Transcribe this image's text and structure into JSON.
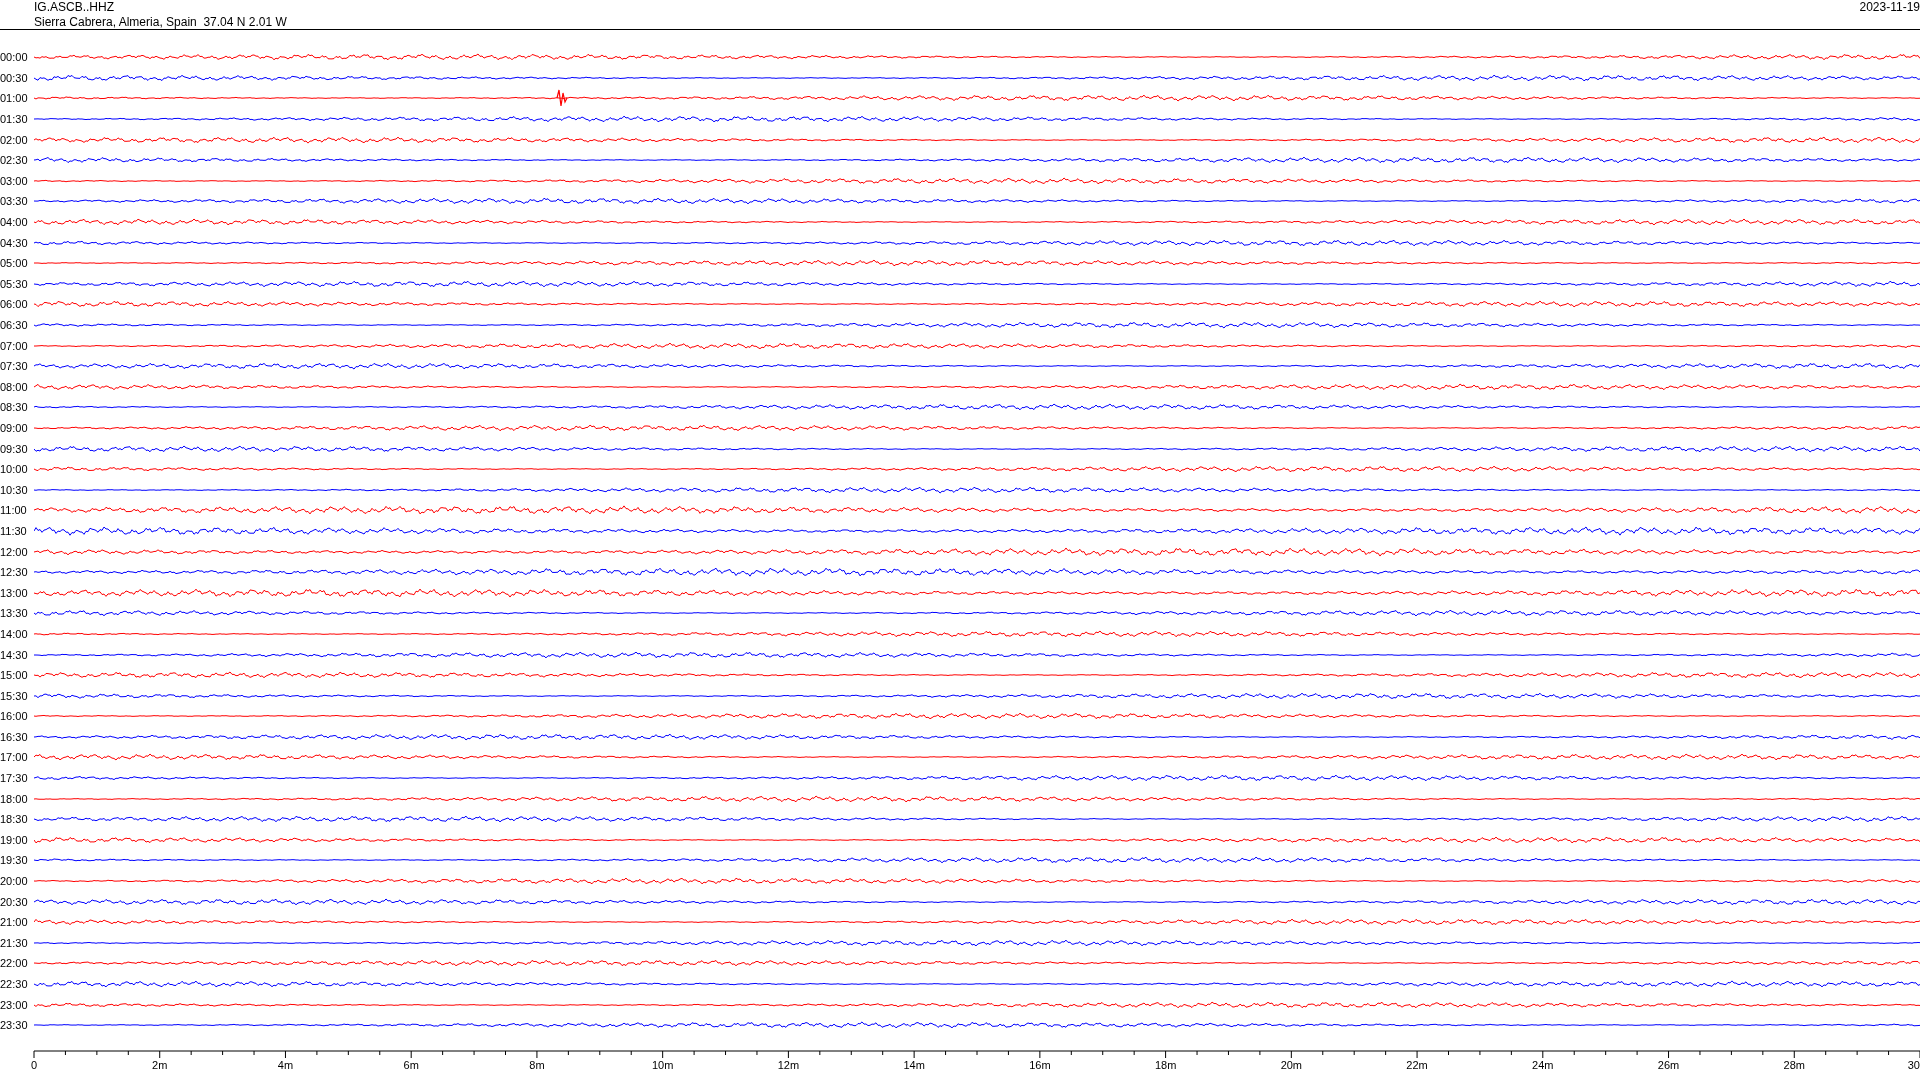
{
  "header": {
    "station": "IG.ASCB..HHZ",
    "location": "Sierra Cabrera, Almeria, Spain  37.04 N 2.01 W",
    "date": "2023-11-19"
  },
  "rows": [
    {
      "label": "00:00",
      "color": "#ff0000"
    },
    {
      "label": "00:30",
      "color": "#0000ff"
    },
    {
      "label": "01:00",
      "color": "#ff0000"
    },
    {
      "label": "01:30",
      "color": "#0000ff"
    },
    {
      "label": "02:00",
      "color": "#ff0000"
    },
    {
      "label": "02:30",
      "color": "#0000ff"
    },
    {
      "label": "03:00",
      "color": "#ff0000"
    },
    {
      "label": "03:30",
      "color": "#0000ff"
    },
    {
      "label": "04:00",
      "color": "#ff0000"
    },
    {
      "label": "04:30",
      "color": "#0000ff"
    },
    {
      "label": "05:00",
      "color": "#ff0000"
    },
    {
      "label": "05:30",
      "color": "#0000ff"
    },
    {
      "label": "06:00",
      "color": "#ff0000"
    },
    {
      "label": "06:30",
      "color": "#0000ff"
    },
    {
      "label": "07:00",
      "color": "#ff0000"
    },
    {
      "label": "07:30",
      "color": "#0000ff"
    },
    {
      "label": "08:00",
      "color": "#ff0000"
    },
    {
      "label": "08:30",
      "color": "#0000ff"
    },
    {
      "label": "09:00",
      "color": "#ff0000"
    },
    {
      "label": "09:30",
      "color": "#0000ff"
    },
    {
      "label": "10:00",
      "color": "#ff0000"
    },
    {
      "label": "10:30",
      "color": "#0000ff"
    },
    {
      "label": "11:00",
      "color": "#ff0000"
    },
    {
      "label": "11:30",
      "color": "#0000ff"
    },
    {
      "label": "12:00",
      "color": "#ff0000"
    },
    {
      "label": "12:30",
      "color": "#0000ff"
    },
    {
      "label": "13:00",
      "color": "#ff0000"
    },
    {
      "label": "13:30",
      "color": "#0000ff"
    },
    {
      "label": "14:00",
      "color": "#ff0000"
    },
    {
      "label": "14:30",
      "color": "#0000ff"
    },
    {
      "label": "15:00",
      "color": "#ff0000"
    },
    {
      "label": "15:30",
      "color": "#0000ff"
    },
    {
      "label": "16:00",
      "color": "#ff0000"
    },
    {
      "label": "16:30",
      "color": "#0000ff"
    },
    {
      "label": "17:00",
      "color": "#ff0000"
    },
    {
      "label": "17:30",
      "color": "#0000ff"
    },
    {
      "label": "18:00",
      "color": "#ff0000"
    },
    {
      "label": "18:30",
      "color": "#0000ff"
    },
    {
      "label": "19:00",
      "color": "#ff0000"
    },
    {
      "label": "19:30",
      "color": "#0000ff"
    },
    {
      "label": "20:00",
      "color": "#ff0000"
    },
    {
      "label": "20:30",
      "color": "#0000ff"
    },
    {
      "label": "21:00",
      "color": "#ff0000"
    },
    {
      "label": "21:30",
      "color": "#0000ff"
    },
    {
      "label": "22:00",
      "color": "#ff0000"
    },
    {
      "label": "22:30",
      "color": "#0000ff"
    },
    {
      "label": "23:00",
      "color": "#ff0000"
    },
    {
      "label": "23:30",
      "color": "#0000ff"
    }
  ],
  "axis": {
    "labels": [
      "0",
      "2m",
      "4m",
      "6m",
      "8m",
      "10m",
      "12m",
      "14m",
      "16m",
      "18m",
      "20m",
      "22m",
      "24m",
      "26m",
      "28m",
      "30"
    ]
  }
}
